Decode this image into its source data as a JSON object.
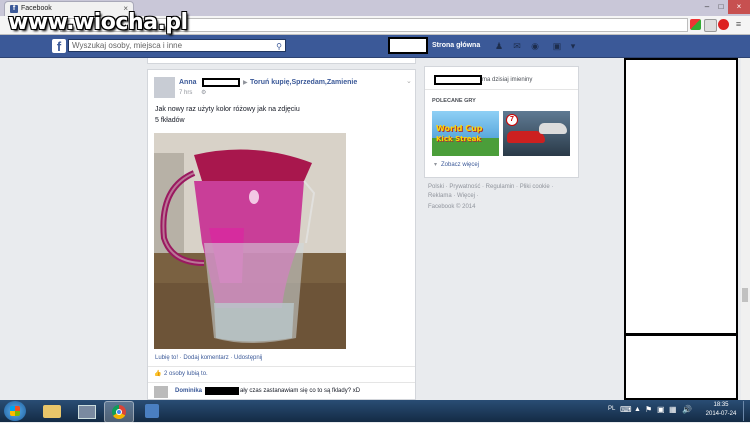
{
  "browser": {
    "tab_title": "Facebook",
    "tab_close": "×",
    "window_controls": [
      "–",
      "□",
      "×"
    ]
  },
  "watermark": "www.wiocha.pl",
  "facebook": {
    "logo": "f",
    "search_placeholder": "Wyszukaj osoby, miejsca i inne",
    "home": "Strona główna"
  },
  "post": {
    "author": "Anna",
    "group": "Toruń kupię,Sprzedam,Zamienie",
    "time": "7 hrs",
    "text_line1": "Jak nowy raz użyty kolor różowy jak na zdjęciu",
    "text_line2": "5 fkładów",
    "actions": "Lubię to! · Dodaj komentarz · Udostępnij",
    "likes": "2 osoby lubią to.",
    "comment_author": "Dominika",
    "comment_text": "ały czas zastanawiam się co to są fklady? xD"
  },
  "sidebar": {
    "birthday_text": "ma dzisiaj imieniny",
    "games_header": "POLECANE GRY",
    "game1_title": "World Cup",
    "game1_sub": "Kick Streak",
    "see_more": "Zobacz więcej",
    "footer_line1": "Polski · Prywatność · Regulamin · Pliki cookie ·",
    "footer_line2": "Reklama · Więcej ·",
    "footer_line3": "Facebook © 2014"
  },
  "taskbar": {
    "lang": "PL",
    "time": "18:35",
    "date": "2014-07-24"
  },
  "colors": {
    "fb_blue": "#3b5998",
    "taskbar": "#1b3a5c"
  }
}
